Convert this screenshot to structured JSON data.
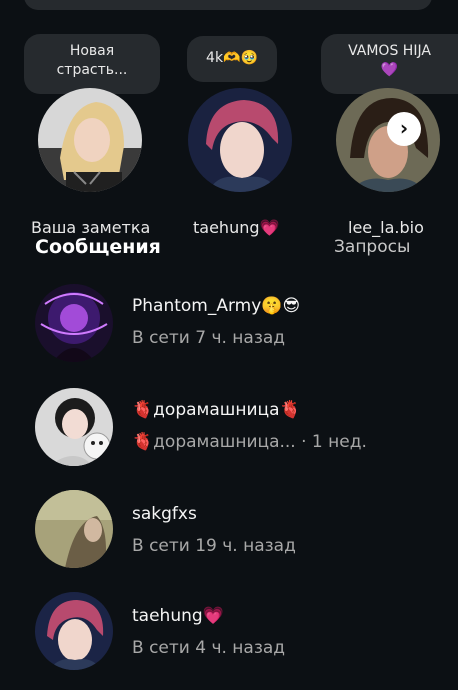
{
  "notes": [
    {
      "bubble": "Новая\nстрасть...",
      "label": "Ваша заметка"
    },
    {
      "bubble": "4k🫶🥹",
      "label": "taehung💗"
    },
    {
      "bubble": "VAMOS HIJA\n💜",
      "label": "lee_la.bio"
    }
  ],
  "messages": {
    "title": "Сообщения",
    "requests_label": "Запросы",
    "items": [
      {
        "name": "Phantom_Army🤫😎",
        "sub": "В сети 7 ч. назад"
      },
      {
        "name": "🫀дорамашница🫀",
        "sub": "🫀дорамашница...",
        "time": " · 1 нед."
      },
      {
        "name": "sakgfxs",
        "sub": "В сети 19 ч. назад"
      },
      {
        "name": "taehung💗",
        "sub": "В сети 4 ч. назад"
      }
    ]
  },
  "colors": {
    "background": "#0c1014",
    "bubble": "#262a2e",
    "muted_text": "#a8a8a8"
  },
  "icons": {
    "carousel_next": "chevron-right-icon"
  }
}
